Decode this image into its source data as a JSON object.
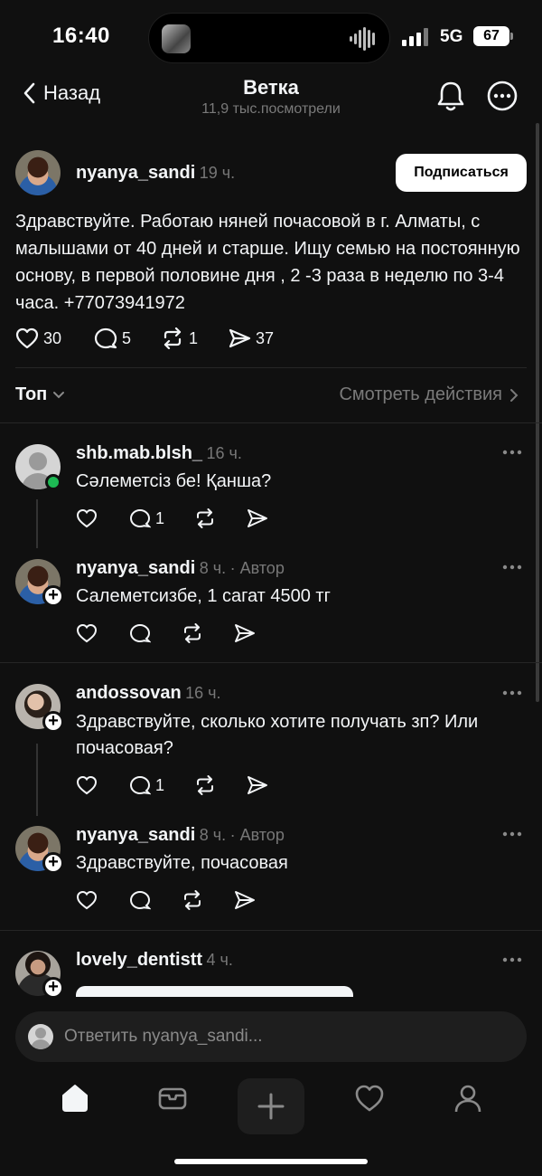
{
  "status_bar": {
    "time": "16:40",
    "network": "5G",
    "battery": "67"
  },
  "header": {
    "back_label": "Назад",
    "title": "Ветка",
    "subtitle": "11,9 тыс.посмотрели"
  },
  "post": {
    "username": "nyanya_sandi",
    "time": "19 ч.",
    "follow_label": "Подписаться",
    "text": "Здравствуйте. Работаю няней почасовой в г. Алматы, с малышами от 40 дней и старше. Ищу семью на постоянную основу, в первой половине дня , 2 -3 раза в неделю по 3-4 часа. +77073941972",
    "likes": "30",
    "comments": "5",
    "reposts": "1",
    "shares": "37"
  },
  "sort": {
    "label": "Топ",
    "activity_link": "Смотреть действия"
  },
  "comments": [
    {
      "username": "shb.mab.blsh_",
      "time": "16 ч.",
      "author": "",
      "text": "Сәлеметсіз бе! Қанша?",
      "replies": "1"
    },
    {
      "username": "nyanya_sandi",
      "time": "8 ч.",
      "author": "· Автор",
      "text": "Салеметсизбе, 1 сагат 4500 тг",
      "replies": ""
    },
    {
      "username": "andossovan",
      "time": "16 ч.",
      "author": "",
      "text": "Здравствуйте, сколько хотите получать зп? Или почасовая?",
      "replies": "1"
    },
    {
      "username": "nyanya_sandi",
      "time": "8 ч.",
      "author": "· Автор",
      "text": "Здравствуйте, почасовая",
      "replies": ""
    },
    {
      "username": "lovely_dentistt",
      "time": "4 ч.",
      "author": "",
      "text": "",
      "replies": ""
    }
  ],
  "reply_bar": {
    "placeholder": "Ответить nyanya_sandi..."
  },
  "icons": {
    "back": "chevron-left-icon",
    "bell": "bell-icon",
    "more": "more-circle-icon",
    "like": "heart-icon",
    "comment": "comment-icon",
    "repost": "repost-icon",
    "share": "share-icon",
    "home": "home-icon",
    "search": "inbox-icon",
    "compose": "plus-icon",
    "activity": "heart-icon",
    "profile": "profile-icon"
  },
  "colors": {
    "background": "#101010",
    "text": "#f3f5f7",
    "muted": "#777777",
    "online": "#1db954"
  }
}
